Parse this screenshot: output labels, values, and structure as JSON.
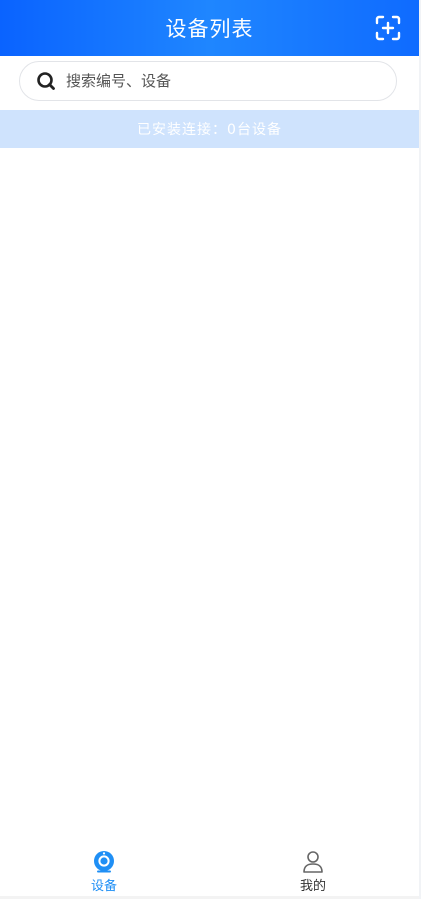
{
  "header": {
    "title": "设备列表",
    "scan_icon": "scan-add-icon"
  },
  "search": {
    "placeholder": "搜索编号、设备",
    "icon": "search-icon"
  },
  "status": {
    "text": "已安装连接：0台设备"
  },
  "tabbar": {
    "tabs": [
      {
        "label": "设备",
        "icon": "camera-icon",
        "active": true
      },
      {
        "label": "我的",
        "icon": "person-icon",
        "active": false
      }
    ]
  },
  "colors": {
    "header_gradient_start": "#0a63ff",
    "header_gradient_end": "#1f86ff",
    "status_bg": "#cfe3fd",
    "active_tab": "#1f8ff5",
    "inactive_tab": "#333333"
  }
}
